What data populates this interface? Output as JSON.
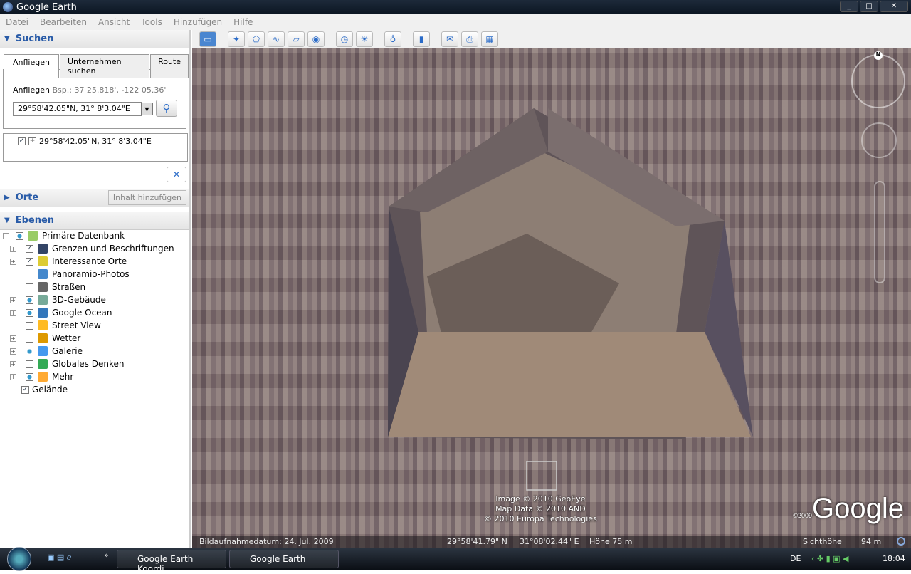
{
  "window": {
    "title": "Google Earth",
    "buttons": [
      "_",
      "□",
      "✕"
    ]
  },
  "menu": [
    "Datei",
    "Bearbeiten",
    "Ansicht",
    "Tools",
    "Hinzufügen",
    "Hilfe"
  ],
  "search": {
    "header": "Suchen",
    "tabs": [
      "Anfliegen",
      "Unternehmen suchen",
      "Route"
    ],
    "label": "Anfliegen",
    "hint": "Bsp.: 37 25.818', -122 05.36'",
    "value": "29°58'42.05\"N, 31° 8'3.04\"E",
    "result": "29°58'42.05\"N, 31° 8'3.04\"E",
    "clear": "✕"
  },
  "places": {
    "header": "Orte",
    "add": "Inhalt hinzufügen"
  },
  "layers": {
    "header": "Ebenen",
    "items": [
      {
        "label": "Primäre Datenbank",
        "state": "partial",
        "color": "#9c6"
      },
      {
        "label": "Grenzen und Beschriftungen",
        "state": "checked",
        "color": "#346"
      },
      {
        "label": "Interessante Orte",
        "state": "checked",
        "color": "#dc3"
      },
      {
        "label": "Panoramio-Photos",
        "state": "off",
        "color": "#48c"
      },
      {
        "label": "Straßen",
        "state": "off",
        "color": "#666"
      },
      {
        "label": "3D-Gebäude",
        "state": "partial",
        "color": "#7a9"
      },
      {
        "label": "Google Ocean",
        "state": "partial",
        "color": "#37b"
      },
      {
        "label": "Street View",
        "state": "off",
        "color": "#fb2"
      },
      {
        "label": "Wetter",
        "state": "off",
        "color": "#d90"
      },
      {
        "label": "Galerie",
        "state": "partial",
        "color": "#49e"
      },
      {
        "label": "Globales Denken",
        "state": "off",
        "color": "#3a5"
      },
      {
        "label": "Mehr",
        "state": "partial",
        "color": "#fa3"
      },
      {
        "label": "Gelände",
        "state": "checked",
        "color": ""
      }
    ]
  },
  "map": {
    "attribution": [
      "Image © 2010 GeoEye",
      "Map Data © 2010 AND",
      "© 2010 Europa Technologies"
    ],
    "logo": "Google",
    "logo_year": "©2009",
    "compass": "N"
  },
  "status": {
    "date": "Bildaufnahmedatum: 24. Jul. 2009",
    "lat": "29°58'41.79\" N",
    "lon": "31°08'02.44\" E",
    "alt": "Höhe  75 m",
    "eye_label": "Sichthöhe",
    "eye": "94 m"
  },
  "taskbar": {
    "tasks": [
      "Google Earth Koordi...",
      "Google Earth"
    ],
    "lang": "DE",
    "time": "18:04"
  }
}
